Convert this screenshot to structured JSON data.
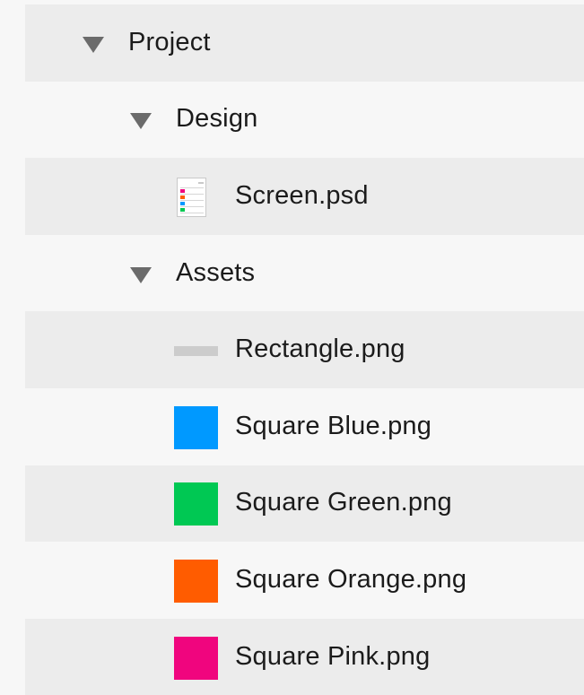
{
  "colors": {
    "row_shaded": "#ececec",
    "row_plain": "#f7f7f7",
    "caret": "#6b6b6b",
    "rectangle_thumb": "#cccccc",
    "square_blue": "#0099ff",
    "square_green": "#00c853",
    "square_orange": "#ff5c00",
    "square_pink": "#f0057e"
  },
  "tree": {
    "project": {
      "label": "Project",
      "icon": "caret-down-icon"
    },
    "design": {
      "label": "Design",
      "icon": "caret-down-icon"
    },
    "screen_psd": {
      "label": "Screen.psd",
      "icon": "psd-document-icon"
    },
    "assets": {
      "label": "Assets",
      "icon": "caret-down-icon"
    },
    "rectangle_png": {
      "label": "Rectangle.png",
      "icon": "rectangle-thumbnail"
    },
    "square_blue_png": {
      "label": "Square Blue.png",
      "icon": "blue-square-thumbnail"
    },
    "square_green_png": {
      "label": "Square Green.png",
      "icon": "green-square-thumbnail"
    },
    "square_orange_png": {
      "label": "Square Orange.png",
      "icon": "orange-square-thumbnail"
    },
    "square_pink_png": {
      "label": "Square Pink.png",
      "icon": "pink-square-thumbnail"
    }
  }
}
